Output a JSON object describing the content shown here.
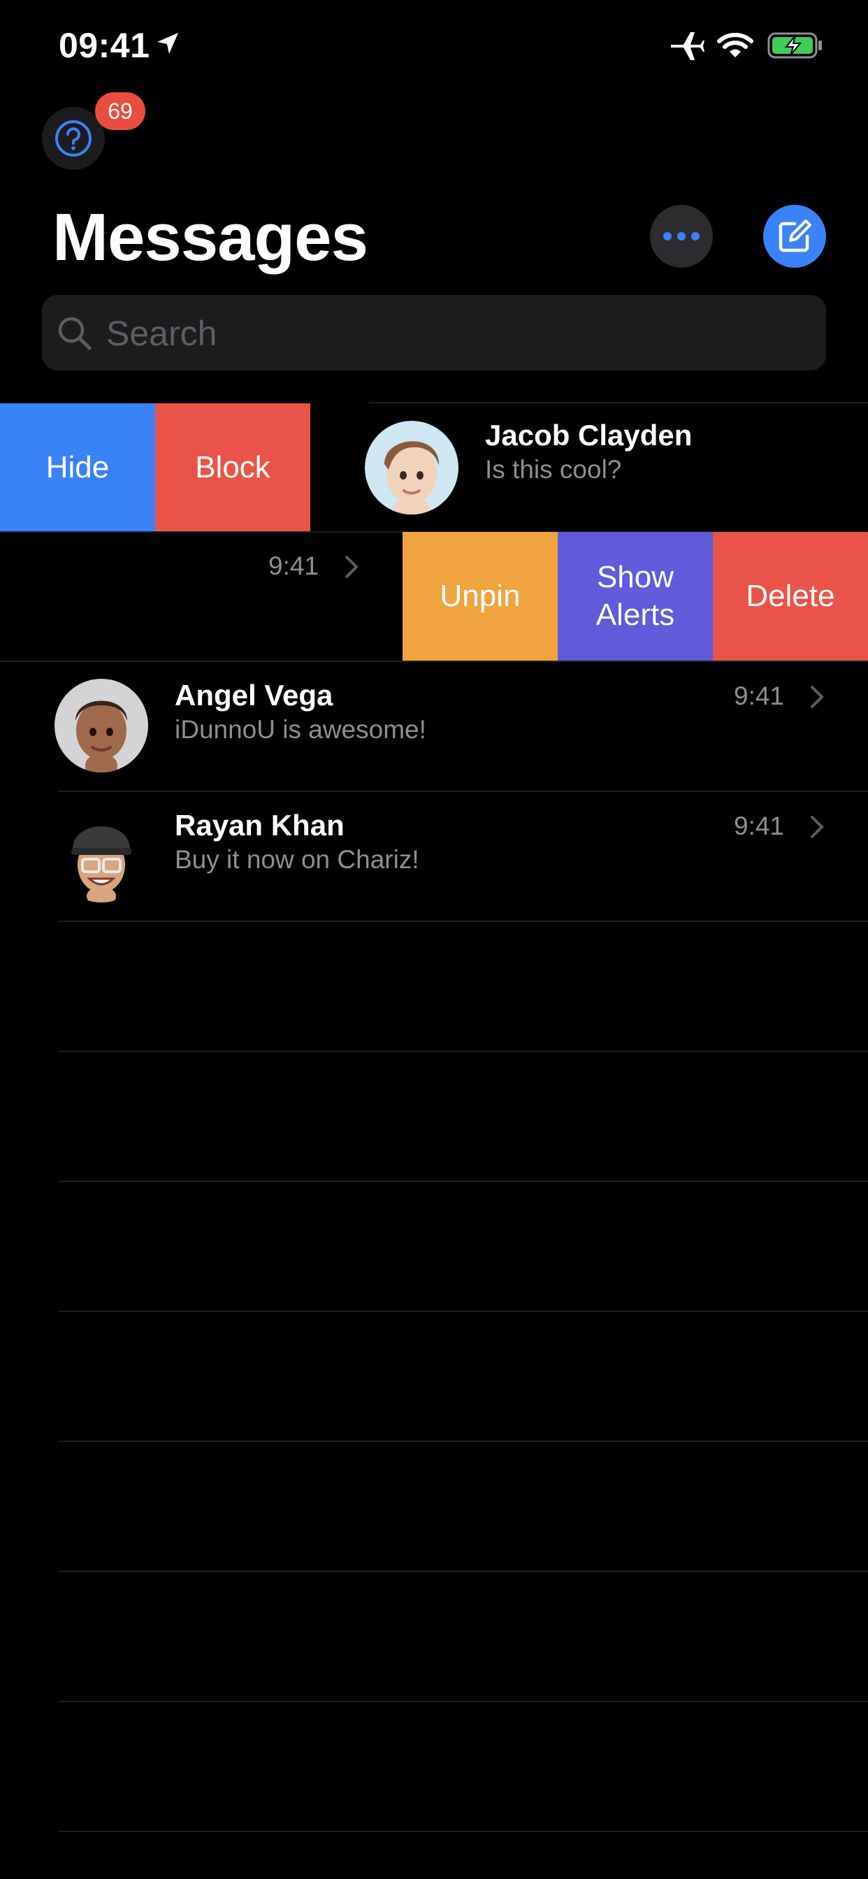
{
  "status_bar": {
    "time": "09:41",
    "icons": [
      "location-arrow-icon",
      "airplane-icon",
      "wifi-icon",
      "battery-charging-icon"
    ]
  },
  "header": {
    "help_icon": "question-circle-icon",
    "badge_count": "69",
    "title": "Messages",
    "more_icon": "ellipsis-icon",
    "compose_icon": "compose-icon"
  },
  "search": {
    "placeholder": "Search",
    "value": ""
  },
  "swipe_actions": {
    "leading": [
      {
        "label": "Hide",
        "color": "#3a82f7"
      },
      {
        "label": "Block",
        "color": "#ea5448"
      }
    ],
    "trailing": [
      {
        "label": "Unpin",
        "color": "#f0a43e"
      },
      {
        "label": "Show\nAlerts",
        "color": "#5f5bdb"
      },
      {
        "label": "Delete",
        "color": "#ea5448"
      }
    ]
  },
  "conversations": [
    {
      "name": "Jacob Clayden",
      "preview": "Is this cool?",
      "avatar": "memoji-light-boy-avatar"
    },
    {
      "name": "",
      "preview": "",
      "time": "9:41",
      "avatar": ""
    },
    {
      "name": "Angel Vega",
      "preview": "iDunnoU is awesome!",
      "time": "9:41",
      "avatar": "memoji-tan-man-avatar"
    },
    {
      "name": "Rayan Khan",
      "preview": "Buy it now on Chariz!",
      "time": "9:41",
      "avatar": "memoji-cap-glasses-avatar"
    }
  ],
  "colors": {
    "background": "#000000",
    "accent": "#3a82f7",
    "badge": "#ea4d3e",
    "secondary_text": "#8e8e93"
  }
}
